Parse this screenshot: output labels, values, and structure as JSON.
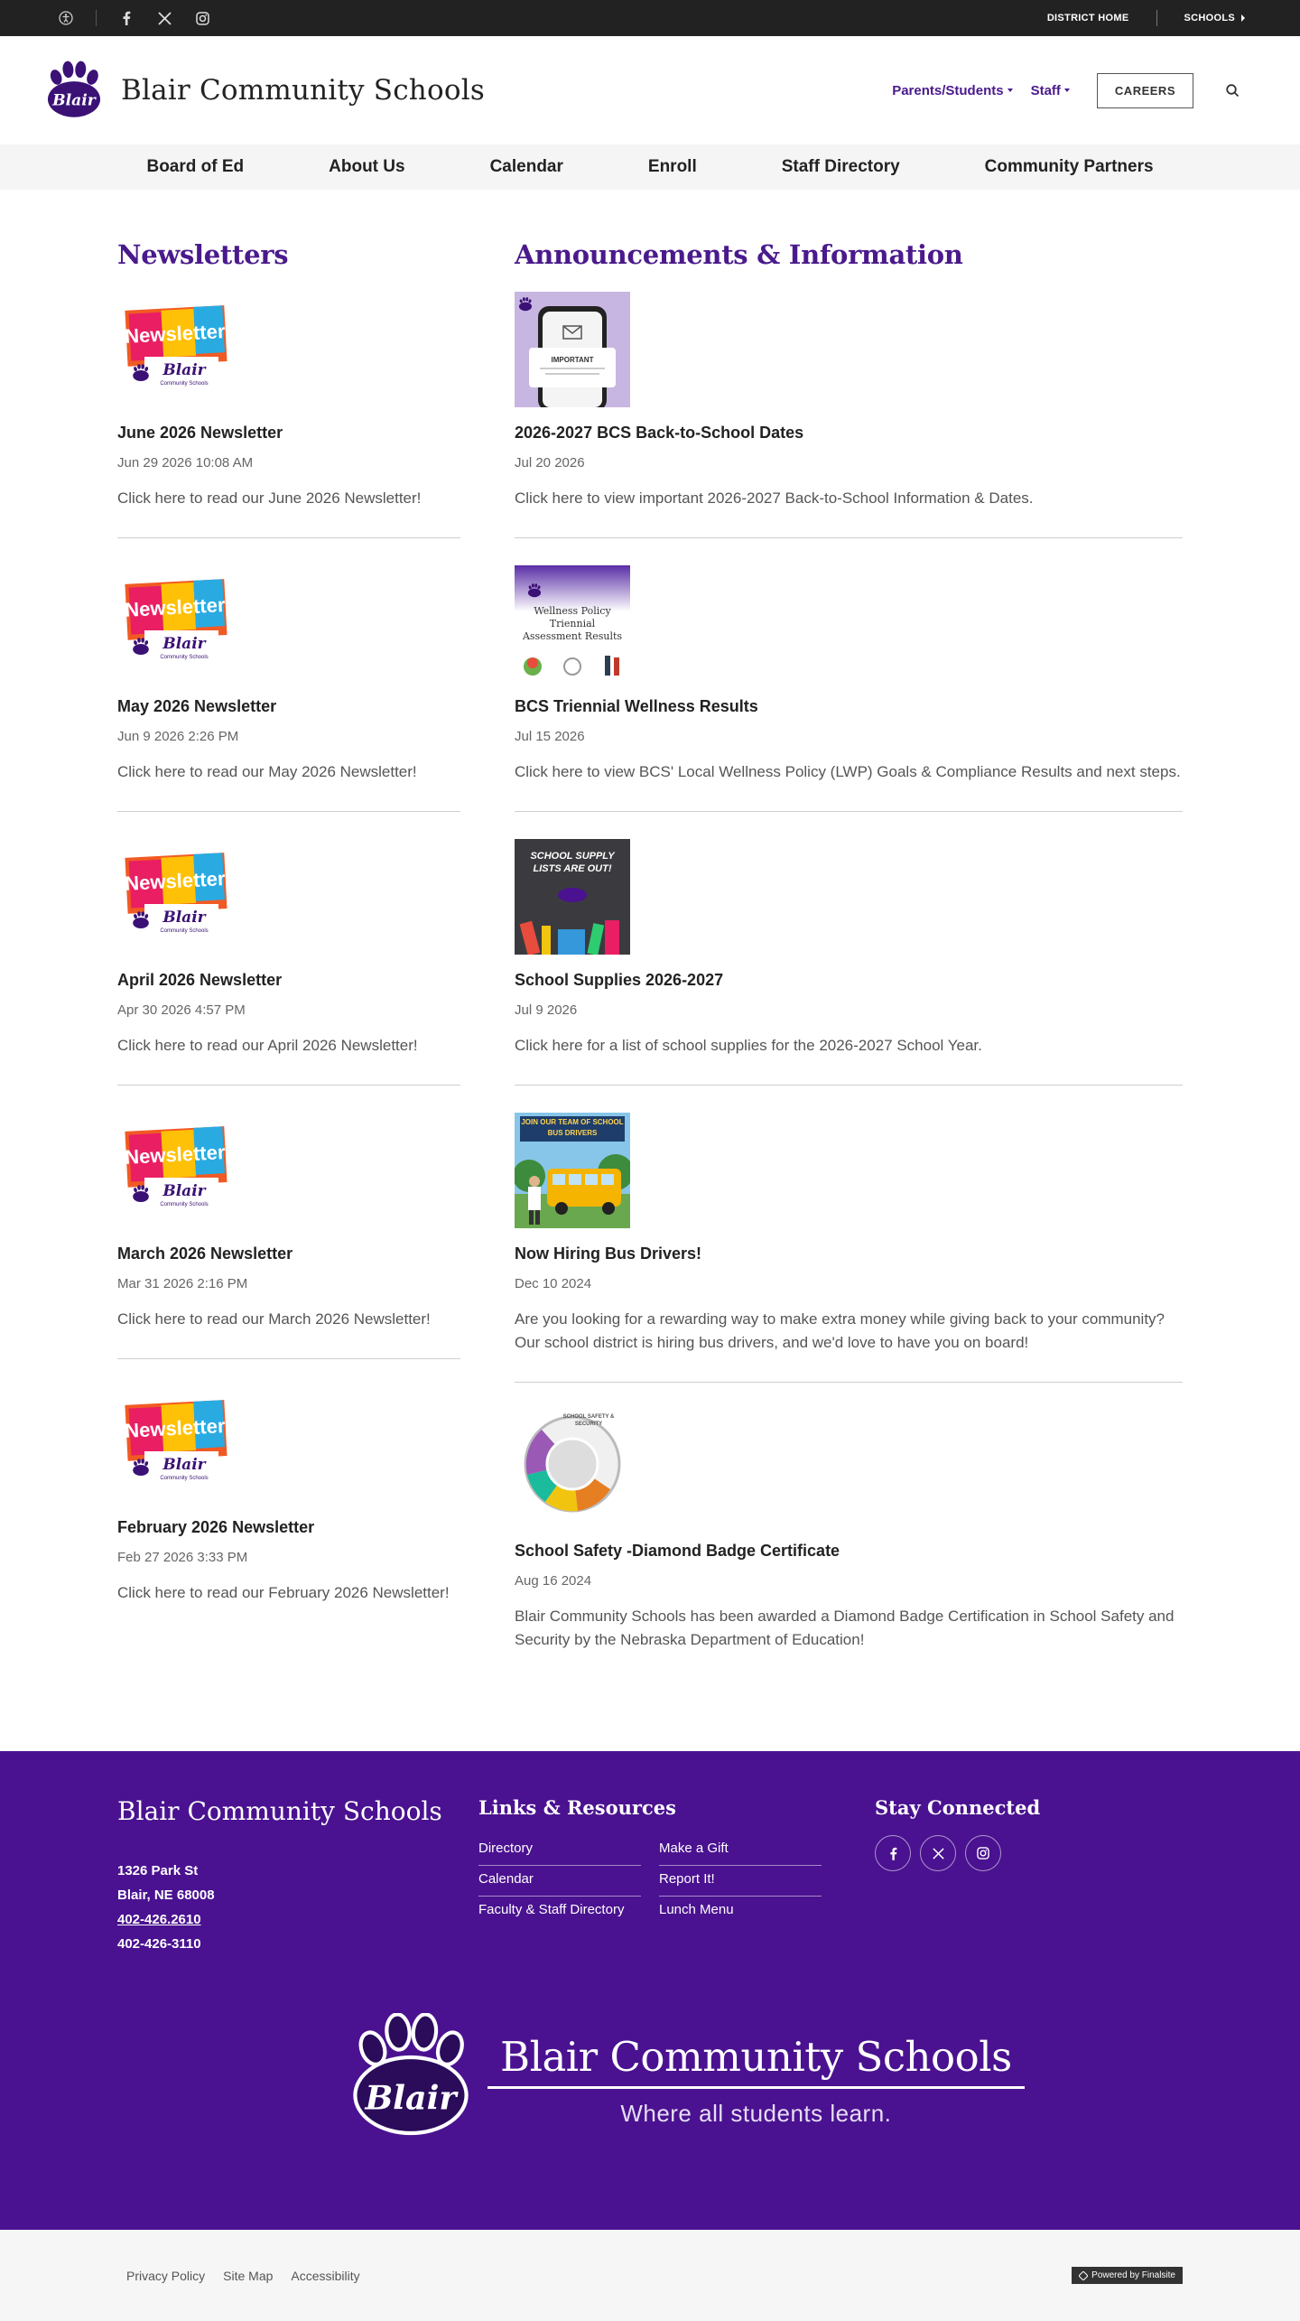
{
  "topbar": {
    "district_home": "DISTRICT HOME",
    "schools": "SCHOOLS",
    "icons": [
      "accessibility-icon",
      "facebook-icon",
      "x-icon",
      "instagram-icon"
    ]
  },
  "header": {
    "site_name": "Blair Community Schools",
    "logo_text": "Blair",
    "parents_students": "Parents/Students",
    "staff": "Staff",
    "careers": "CAREERS"
  },
  "nav": {
    "items": [
      "Board of Ed",
      "About Us",
      "Calendar",
      "Enroll",
      "Staff Directory",
      "Community Partners"
    ]
  },
  "newsletters": {
    "title": "Newsletters",
    "thumb_word": "Newsletter",
    "thumb_brand": "Blair",
    "thumb_sub": "Community Schools",
    "items": [
      {
        "title": "June 2026 Newsletter",
        "date": "Jun 29 2026 10:08 AM",
        "desc": "Click here to read our June 2026 Newsletter!"
      },
      {
        "title": "May 2026 Newsletter",
        "date": "Jun 9 2026 2:26 PM",
        "desc": "Click here to read our May 2026 Newsletter!"
      },
      {
        "title": "April 2026 Newsletter",
        "date": "Apr 30 2026 4:57 PM",
        "desc": "Click here to read our April 2026 Newsletter!"
      },
      {
        "title": "March 2026 Newsletter",
        "date": "Mar 31 2026 2:16 PM",
        "desc": "Click here to read our March 2026 Newsletter!"
      },
      {
        "title": "February 2026 Newsletter",
        "date": "Feb 27 2026 3:33 PM",
        "desc": "Click here to read our February 2026 Newsletter!"
      }
    ]
  },
  "announcements": {
    "title": "Announcements & Information",
    "items": [
      {
        "title": "2026-2027 BCS Back-to-School Dates",
        "date": "Jul 20 2026",
        "desc": "Click here to view important 2026-2027 Back-to-School Information & Dates.",
        "thumb_text": "IMPORTANT"
      },
      {
        "title": "BCS Triennial Wellness Results",
        "date": "Jul 15 2026",
        "desc": "Click here to view BCS' Local Wellness Policy (LWP) Goals & Compliance Results and next steps.",
        "thumb_text": "Wellness Policy Triennial Assessment Results"
      },
      {
        "title": "School Supplies 2026-2027",
        "date": "Jul 9 2026",
        "desc": "Click here for a list of school supplies for the 2026-2027 School Year.",
        "thumb_text": "SCHOOL SUPPLY LISTS ARE OUT!"
      },
      {
        "title": "Now Hiring Bus Drivers!",
        "date": "Dec 10 2024",
        "desc": "Are you looking for a rewarding way to make extra money while giving back to your community? Our school district is hiring bus drivers, and we'd love to have you on board!",
        "thumb_text": "JOIN OUR TEAM OF SCHOOL BUS DRIVERS"
      },
      {
        "title": "School Safety -Diamond Badge Certificate",
        "date": "Aug 16 2024",
        "desc": "Blair Community Schools has been awarded a Diamond Badge Certification in School Safety and Security by the Nebraska Department of Education!",
        "thumb_text": "SCHOOL SAFETY & SECURITY"
      }
    ]
  },
  "footer": {
    "name": "Blair Community Schools",
    "address1": "1326 Park St",
    "address2": "Blair, NE  68008",
    "phone": "402-426.2610",
    "fax": "402-426-3110",
    "links_heading": "Links & Resources",
    "links": [
      "Directory",
      "Make a Gift",
      "Calendar",
      "Report It!",
      "Faculty & Staff Directory",
      "Lunch Menu"
    ],
    "social_heading": "Stay Connected",
    "brand_name": "Blair Community Schools",
    "brand_logo_text": "Blair",
    "tagline": "Where all students learn."
  },
  "bottombar": {
    "links": [
      "Privacy Policy",
      "Site Map",
      "Accessibility"
    ],
    "powered": "Powered by Finalsite"
  },
  "colors": {
    "brand_purple": "#4a1290",
    "accent_purple": "#4a1a8c",
    "topbar": "#222222"
  }
}
